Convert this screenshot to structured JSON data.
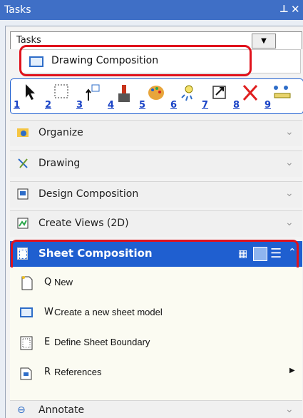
{
  "window": {
    "title": "Tasks",
    "pin_glyph": " 1",
    "close_glyph": "✕"
  },
  "dropdown": {
    "label": "Tasks",
    "arrow": "▼"
  },
  "task_selected": {
    "label": "Drawing Composition"
  },
  "toolbar": {
    "tools": [
      {
        "num": "1",
        "icon": "element-selection-icon"
      },
      {
        "num": "2",
        "icon": "rectangle-select-icon"
      },
      {
        "num": "3",
        "icon": "move-icon"
      },
      {
        "num": "4",
        "icon": "brush-icon"
      },
      {
        "num": "5",
        "icon": "palette-icon"
      },
      {
        "num": "6",
        "icon": "lightbulb-icon"
      },
      {
        "num": "7",
        "icon": "scale-icon"
      },
      {
        "num": "8",
        "icon": "delete-icon"
      },
      {
        "num": "9",
        "icon": "measure-icon"
      }
    ]
  },
  "sections": [
    {
      "label": "Organize",
      "icon": "organize-icon"
    },
    {
      "label": "Drawing",
      "icon": "drawing-icon"
    },
    {
      "label": "Design Composition",
      "icon": "design-composition-icon"
    },
    {
      "label": "Create Views (2D)",
      "icon": "create-views-icon"
    }
  ],
  "sheet": {
    "label": "Sheet Composition",
    "items": [
      {
        "key": "Q",
        "label": "New",
        "icon": "new-document-icon"
      },
      {
        "key": "W",
        "label": "Create a new sheet model",
        "icon": "sheet-model-icon"
      },
      {
        "key": "E",
        "label": "Define Sheet Boundary",
        "icon": "sheet-boundary-icon"
      },
      {
        "key": "R",
        "label": "References",
        "icon": "references-icon",
        "submenu": "▶"
      }
    ]
  },
  "annotate": {
    "label": "Annotate"
  },
  "colors": {
    "accent": "#1f5fd0",
    "highlight": "#e0121c",
    "titlebar": "#3f6fc6"
  }
}
